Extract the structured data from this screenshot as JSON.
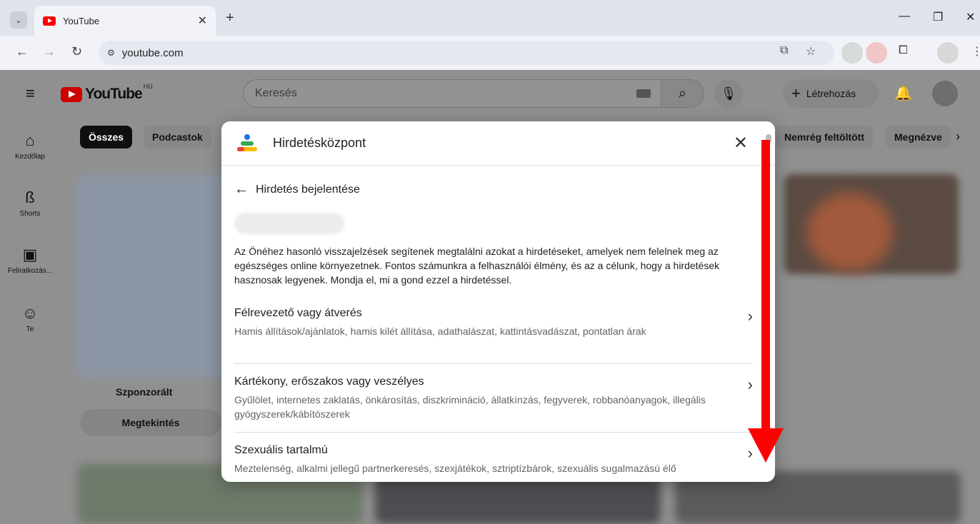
{
  "browser": {
    "tab_title": "YouTube",
    "tab_close": "✕",
    "new_tab": "+",
    "url": "youtube.com",
    "win_min": "—",
    "win_restore": "❐",
    "win_close": "✕"
  },
  "header": {
    "logo_text": "YouTube",
    "country_code": "HU",
    "search_placeholder": "Keresés",
    "create_label": "Létrehozás"
  },
  "sidebar": {
    "items": [
      {
        "label": "Kezdőlap",
        "icon": "home-icon"
      },
      {
        "label": "Shorts",
        "icon": "shorts-icon"
      },
      {
        "label": "Feliratkozás...",
        "icon": "subscriptions-icon"
      },
      {
        "label": "Te",
        "icon": "account-icon"
      }
    ]
  },
  "chips": [
    "Összes",
    "Podcastok",
    "Nemrég feltöltött",
    "Megnézve"
  ],
  "ad_card": {
    "sponsor_label": "Szponzorált",
    "watch_label": "Megtekintés"
  },
  "modal": {
    "title": "Hirdetésközpont",
    "close": "✕",
    "back_label": "Hirdetés bejelentése",
    "intro": "Az Önéhez hasonló visszajelzések segítenek megtalálni azokat a hirdetéseket, amelyek nem felelnek meg az egészséges online környezetnek. Fontos számunkra a felhasználói élmény, és az a célunk, hogy a hirdetések hasznosak legyenek. Mondja el, mi a gond ezzel a hirdetéssel.",
    "categories": [
      {
        "title": "Félrevezető vagy átverés",
        "desc": "Hamis állítások/ajánlatok, hamis kilét állítása, adathalászat, kattintásvadászat, pontatlan árak"
      },
      {
        "title": "Kártékony, erőszakos vagy veszélyes",
        "desc": "Gyűlölet, internetes zaklatás, önkárosítás, diszkrimináció, állatkínzás, fegyverek, robbanóanyagok, illegális gyógyszerek/kábítószerek"
      },
      {
        "title": "Szexuális tartalmú",
        "desc": "Meztelenség, alkalmi jellegű partnerkeresés, szexjátékok, sztriptízbárok, szexuális sugalmazású élő"
      }
    ]
  },
  "colors": {
    "youtube_red": "#ff0000",
    "annotation_arrow": "#ff0000",
    "overlay_gray": "#909090"
  }
}
